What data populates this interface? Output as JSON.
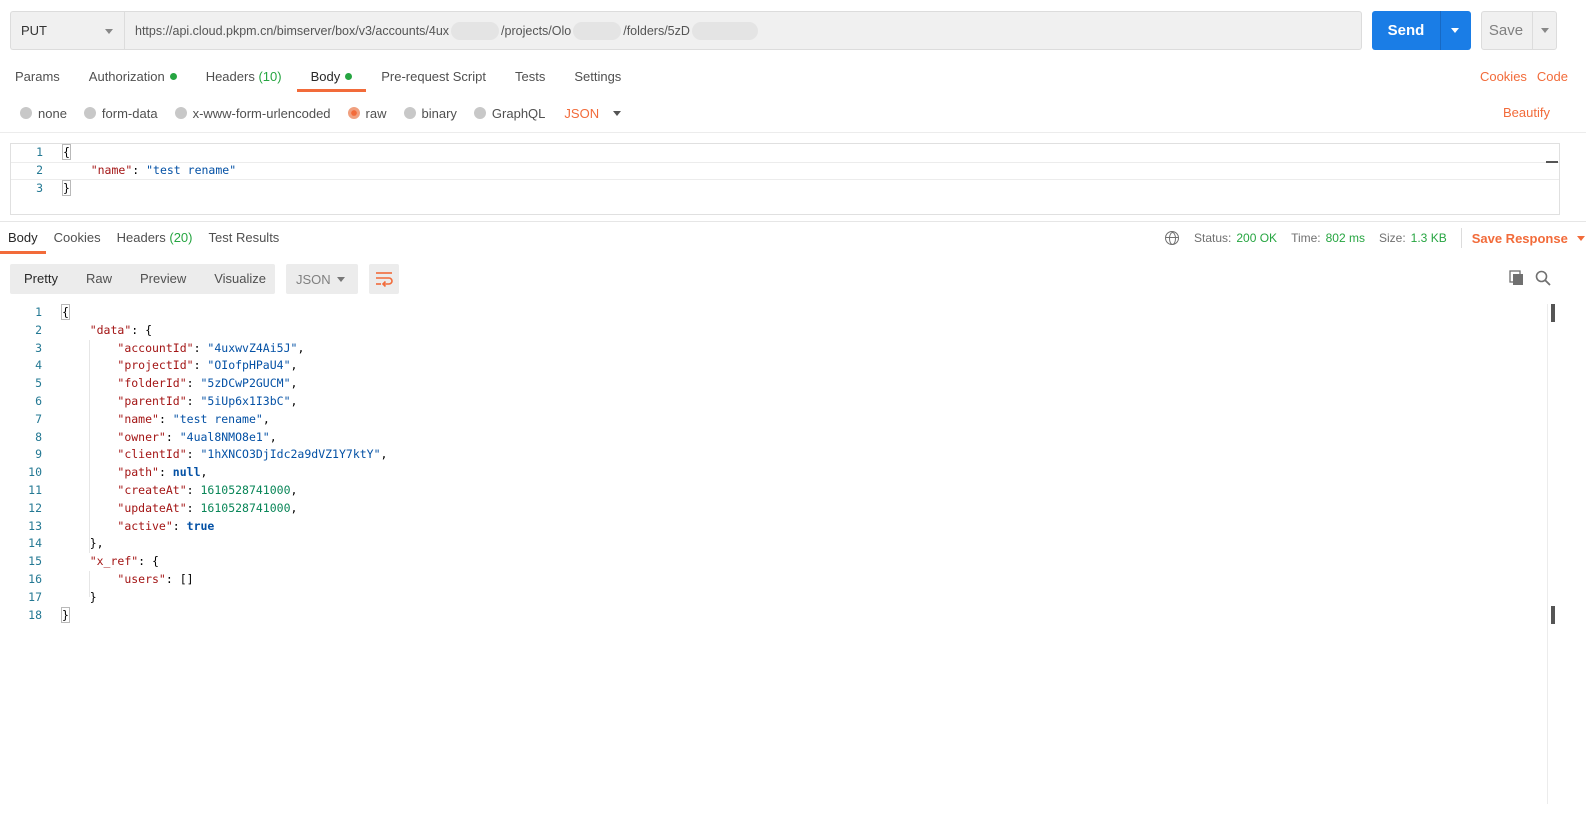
{
  "request": {
    "method": "PUT",
    "url_parts": [
      "https://api.cloud.pkpm.cn/bimserver/box/v3/accounts/4ux",
      "/projects/Olo",
      "/folders/5zD"
    ],
    "send_label": "Send",
    "save_label": "Save"
  },
  "request_tabs": [
    {
      "label": "Params"
    },
    {
      "label": "Authorization"
    },
    {
      "label": "Headers",
      "count": "(10)"
    },
    {
      "label": "Body"
    },
    {
      "label": "Pre-request Script"
    },
    {
      "label": "Tests"
    },
    {
      "label": "Settings"
    }
  ],
  "request_links": {
    "cookies": "Cookies",
    "code": "Code"
  },
  "body_types": [
    "none",
    "form-data",
    "x-www-form-urlencoded",
    "raw",
    "binary",
    "GraphQL"
  ],
  "body_format": "JSON",
  "beautify_label": "Beautify",
  "request_body": {
    "line_numbers": [
      "1",
      "2",
      "3"
    ],
    "open_brace": "{",
    "key": "\"name\"",
    "value": "\"test rename\"",
    "close_brace": "}"
  },
  "response_tabs": [
    {
      "label": "Body"
    },
    {
      "label": "Cookies"
    },
    {
      "label": "Headers",
      "count": "(20)"
    },
    {
      "label": "Test Results"
    }
  ],
  "response_status": {
    "status_label": "Status:",
    "status_value": "200 OK",
    "time_label": "Time:",
    "time_value": "802 ms",
    "size_label": "Size:",
    "size_value": "1.3 KB",
    "save_response": "Save Response"
  },
  "response_views": [
    "Pretty",
    "Raw",
    "Preview",
    "Visualize"
  ],
  "response_format": "JSON",
  "response_body": {
    "line_numbers": [
      "1",
      "2",
      "3",
      "4",
      "5",
      "6",
      "7",
      "8",
      "9",
      "10",
      "11",
      "12",
      "13",
      "14",
      "15",
      "16",
      "17",
      "18"
    ],
    "open": "{",
    "data_key": "\"data\"",
    "fields": [
      {
        "key": "\"accountId\"",
        "value": "\"4uxwvZ4Ai5J\"",
        "kind": "str",
        "comma": ","
      },
      {
        "key": "\"projectId\"",
        "value": "\"OIofpHPaU4\"",
        "kind": "str",
        "comma": ","
      },
      {
        "key": "\"folderId\"",
        "value": "\"5zDCwP2GUCM\"",
        "kind": "str",
        "comma": ","
      },
      {
        "key": "\"parentId\"",
        "value": "\"5iUp6x1I3bC\"",
        "kind": "str",
        "comma": ","
      },
      {
        "key": "\"name\"",
        "value": "\"test rename\"",
        "kind": "str",
        "comma": ","
      },
      {
        "key": "\"owner\"",
        "value": "\"4ual8NMO8e1\"",
        "kind": "str",
        "comma": ","
      },
      {
        "key": "\"clientId\"",
        "value": "\"1hXNCO3DjIdc2a9dVZ1Y7ktY\"",
        "kind": "str",
        "comma": ","
      },
      {
        "key": "\"path\"",
        "value": "null",
        "kind": "kw",
        "comma": ","
      },
      {
        "key": "\"createAt\"",
        "value": "1610528741000",
        "kind": "num",
        "comma": ","
      },
      {
        "key": "\"updateAt\"",
        "value": "1610528741000",
        "kind": "num",
        "comma": ","
      },
      {
        "key": "\"active\"",
        "value": "true",
        "kind": "kw",
        "comma": ""
      }
    ],
    "data_close": "},",
    "xref_key": "\"x_ref\"",
    "users_key": "\"users\"",
    "users_value": "[]",
    "xref_close": "}",
    "close": "}"
  }
}
